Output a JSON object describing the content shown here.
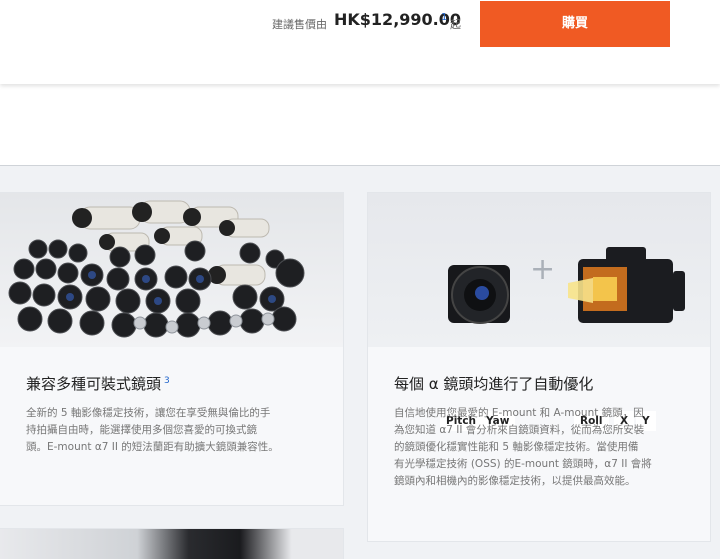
{
  "header": {
    "price_label": "建議售價由",
    "price_value": "HK$12,990.00",
    "price_footnote": "1",
    "price_suffix": "起",
    "buy_label": "購買",
    "buy_color": "#f05a23"
  },
  "cards": [
    {
      "image_icon": "lens-collection-photo",
      "title": "兼容多種可裝式鏡頭",
      "footnote": "3",
      "lines": [
        "全新的 5 軸影像穩定技術，讓您在享受無與倫比的手",
        "持拍攝自由時，能選擇使用多個您喜愛的可換式鏡",
        "頭。E-mount α7 II 的短法蘭距有助擴大鏡頭兼容性。"
      ]
    },
    {
      "image_icon": "lens-and-camera-stabilization-diagram",
      "tags": [
        "Pitch",
        "Yaw",
        "Roll",
        "X",
        "Y"
      ],
      "plus_icon": "+",
      "title": "每個 α 鏡頭均進行了自動優化",
      "lines": [
        "自信地使用您最愛的 E-mount 和 A-mount 鏡頭，因",
        "為您知道 α7 II 會分析來自鏡頭資料，從而為您所安裝",
        "的鏡頭優化穩實性能和 5 軸影像穩定技術。當使用備",
        "有光學穩定技術 (OSS) 的E-mount 鏡頭時，α7 II 會將",
        "鏡頭內和相機內的影像穩定技術，以提供最高效能。"
      ]
    }
  ]
}
